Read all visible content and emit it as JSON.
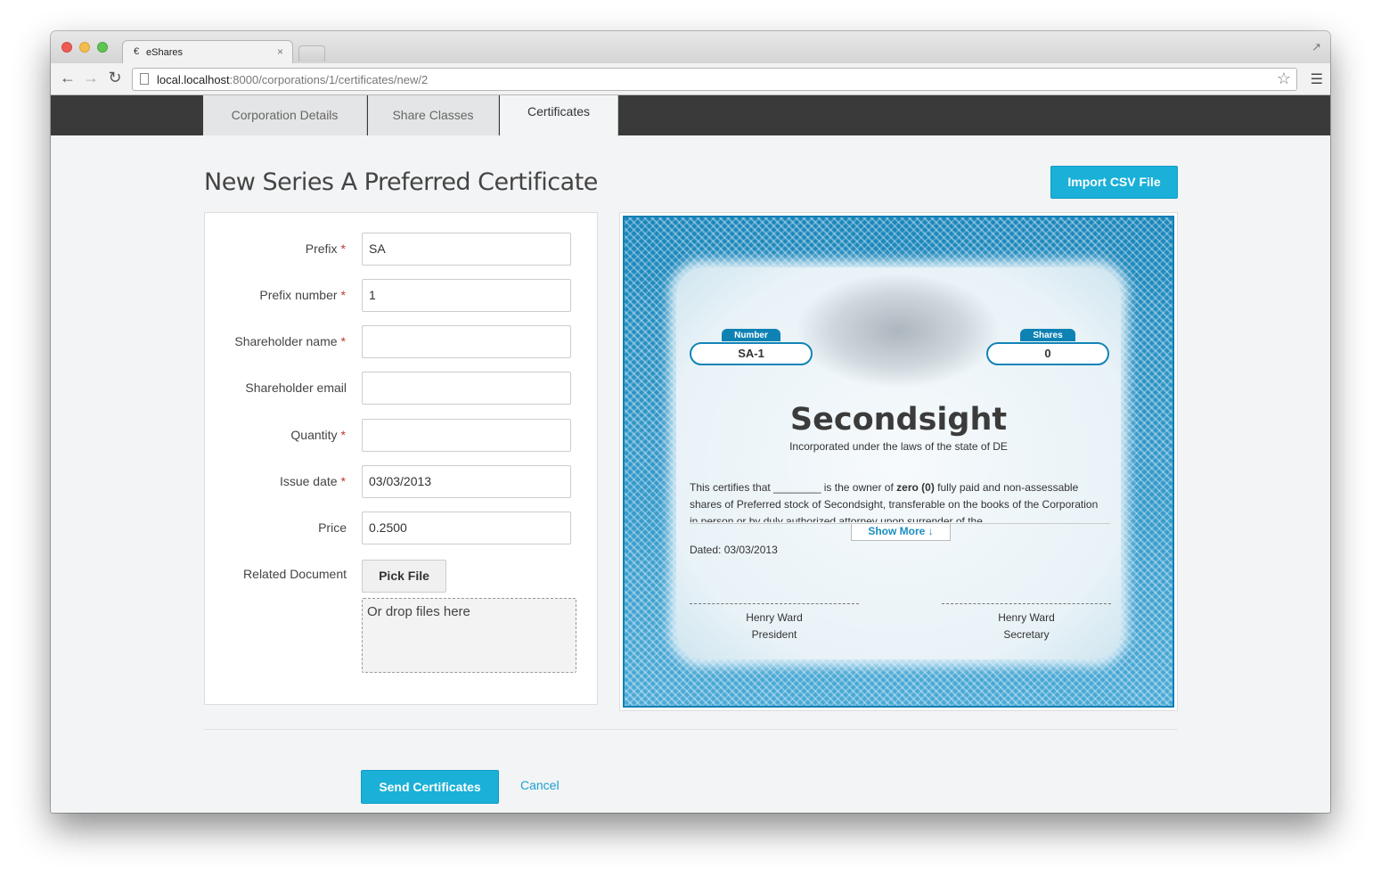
{
  "browser": {
    "tab_title": "eShares",
    "url_host": "local.localhost",
    "url_path": ":8000/corporations/1/certificates/new/2"
  },
  "app_tabs": [
    {
      "label": "Corporation Details"
    },
    {
      "label": "Share Classes"
    },
    {
      "label": "Certificates",
      "active": true
    }
  ],
  "page": {
    "title": "New Series A Preferred Certificate",
    "import_label": "Import CSV File"
  },
  "form": {
    "required_mark": "*",
    "fields": [
      {
        "label": "Prefix",
        "value": "SA",
        "required": true
      },
      {
        "label": "Prefix number",
        "value": "1",
        "required": true
      },
      {
        "label": "Shareholder name",
        "value": "",
        "required": true
      },
      {
        "label": "Shareholder email",
        "value": "",
        "required": false
      },
      {
        "label": "Quantity",
        "value": "",
        "required": true
      },
      {
        "label": "Issue date",
        "value": "03/03/2013",
        "required": true
      },
      {
        "label": "Price",
        "value": "0.2500",
        "required": false
      }
    ],
    "document_label": "Related Document",
    "pick_file_label": "Pick File",
    "drop_text": "Or drop files here"
  },
  "certificate": {
    "number_label": "Number",
    "number_value": "SA-1",
    "shares_label": "Shares",
    "shares_value": "0",
    "company": "Secondsight",
    "incorporated": "Incorporated under the laws of the state of DE",
    "body_1": "This certifies that ________ is the owner of ",
    "body_bold": "zero (0)",
    "body_2": " fully paid and non-assessable shares of Preferred stock of Secondsight, transferable on the books of the Corporation in person or by duly authorized attorney upon surrender of the",
    "show_more": "Show More  ↓",
    "dated": "Dated: 03/03/2013",
    "signers": [
      {
        "name": "Henry Ward",
        "title": "President"
      },
      {
        "name": "Henry Ward",
        "title": "Secretary"
      }
    ]
  },
  "actions": {
    "send_label": "Send Certificates",
    "cancel_label": "Cancel"
  },
  "colors": {
    "accent": "#1ab0d8",
    "header_bg": "#3a3a3a",
    "required": "#c0392b"
  }
}
